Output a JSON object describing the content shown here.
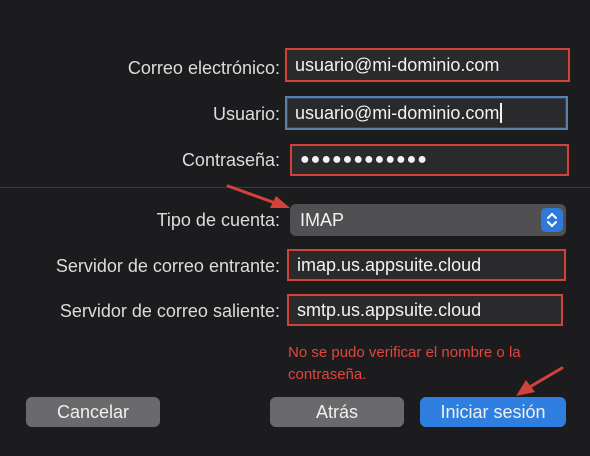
{
  "form": {
    "email_label": "Correo electrónico:",
    "email_value": "usuario@mi-dominio.com",
    "user_label": "Usuario:",
    "user_value": "usuario@mi-dominio.com",
    "password_label": "Contraseña:",
    "password_value": "●●●●●●●●●●●●",
    "account_type_label": "Tipo de cuenta:",
    "account_type_value": "IMAP",
    "incoming_label": "Servidor de correo entrante:",
    "incoming_value": "imap.us.appsuite.cloud",
    "outgoing_label": "Servidor de correo saliente:",
    "outgoing_value": "smtp.us.appsuite.cloud"
  },
  "error": {
    "message": "No se pudo verificar el nombre o la contraseña."
  },
  "buttons": {
    "cancel": "Cancelar",
    "back": "Atrás",
    "sign_in": "Iniciar sesión"
  },
  "colors": {
    "highlight_red": "#d0423a",
    "error_red": "#e0463f",
    "primary_blue": "#2f7fe0",
    "dialog_bg": "#1c1c1e"
  }
}
